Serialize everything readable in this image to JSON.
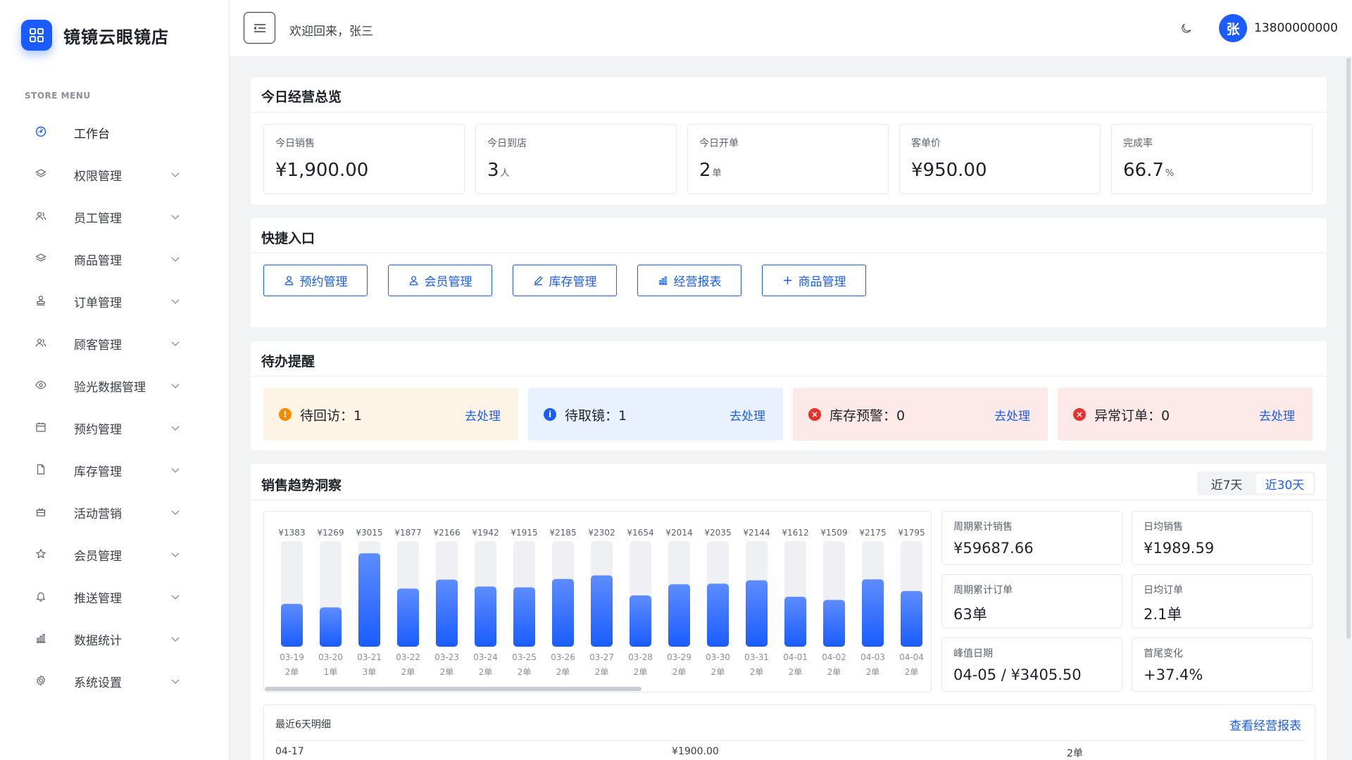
{
  "app": {
    "brand": "镜镜云眼镜店",
    "menu_caption": "STORE MENU"
  },
  "sidebar": {
    "items": [
      {
        "label": "工作台",
        "icon": "dashboard-icon",
        "active": true
      },
      {
        "label": "权限管理",
        "icon": "layers-icon"
      },
      {
        "label": "员工管理",
        "icon": "users-icon"
      },
      {
        "label": "商品管理",
        "icon": "layers-icon"
      },
      {
        "label": "订单管理",
        "icon": "stamp-icon"
      },
      {
        "label": "顾客管理",
        "icon": "users-icon"
      },
      {
        "label": "验光数据管理",
        "icon": "eye-icon"
      },
      {
        "label": "预约管理",
        "icon": "calendar-icon"
      },
      {
        "label": "库存管理",
        "icon": "document-icon"
      },
      {
        "label": "活动营销",
        "icon": "gift-icon"
      },
      {
        "label": "会员管理",
        "icon": "star-icon"
      },
      {
        "label": "推送管理",
        "icon": "bell-icon"
      },
      {
        "label": "数据统计",
        "icon": "bar-chart-icon"
      },
      {
        "label": "系统设置",
        "icon": "gear-icon"
      }
    ]
  },
  "header": {
    "welcome": "欢迎回来，张三",
    "avatar_text": "张",
    "phone": "13800000000"
  },
  "overview": {
    "title": "今日经营总览",
    "stats": [
      {
        "label": "今日销售",
        "value": "¥1,900.00",
        "unit": ""
      },
      {
        "label": "今日到店",
        "value": "3",
        "unit": "人"
      },
      {
        "label": "今日开单",
        "value": "2",
        "unit": "单"
      },
      {
        "label": "客单价",
        "value": "¥950.00",
        "unit": ""
      },
      {
        "label": "完成率",
        "value": "66.7",
        "unit": "%"
      }
    ]
  },
  "quick": {
    "title": "快捷入口",
    "buttons": [
      {
        "label": "预约管理",
        "icon": "user-icon"
      },
      {
        "label": "会员管理",
        "icon": "user-icon"
      },
      {
        "label": "库存管理",
        "icon": "edit-icon"
      },
      {
        "label": "经营报表",
        "icon": "bar-chart-icon"
      },
      {
        "label": "商品管理",
        "icon": "plus-icon"
      }
    ]
  },
  "todo": {
    "title": "待办提醒",
    "items": [
      {
        "label": "待回访：1",
        "action": "去处理",
        "type": "warning",
        "bg": "#fdf4e6",
        "icon_color": "#f08c00",
        "icon_glyph": "!"
      },
      {
        "label": "待取镜：1",
        "action": "去处理",
        "type": "info",
        "bg": "#e8f1fd",
        "icon_color": "#1a5cff",
        "icon_glyph": "i"
      },
      {
        "label": "库存预警：0",
        "action": "去处理",
        "type": "danger",
        "bg": "#fde9e8",
        "icon_color": "#e5322d",
        "icon_glyph": "×"
      },
      {
        "label": "异常订单：0",
        "action": "去处理",
        "type": "danger",
        "bg": "#fde9e8",
        "icon_color": "#e5322d",
        "icon_glyph": "×"
      }
    ]
  },
  "trend": {
    "title": "销售趋势洞察",
    "range_options": [
      "近7天",
      "近30天"
    ],
    "range_selected": "近30天",
    "metrics": [
      {
        "label": "周期累计销售",
        "value": "¥59687.66"
      },
      {
        "label": "日均销售",
        "value": "¥1989.59"
      },
      {
        "label": "周期累计订单",
        "value": "63单"
      },
      {
        "label": "日均订单",
        "value": "2.1单"
      },
      {
        "label": "峰值日期",
        "value": "04-05 / ¥3405.50"
      },
      {
        "label": "首尾变化",
        "value": "+37.4%"
      }
    ]
  },
  "chart_data": {
    "type": "bar",
    "categories": [
      "03-19",
      "03-20",
      "03-21",
      "03-22",
      "03-23",
      "03-24",
      "03-25",
      "03-26",
      "03-27",
      "03-28",
      "03-29",
      "03-30",
      "03-31",
      "04-01",
      "04-02",
      "04-03",
      "04-04"
    ],
    "values": [
      1383,
      1269,
      3015,
      1877,
      2166,
      1942,
      1915,
      2185,
      2302,
      1654,
      2014,
      2035,
      2144,
      1612,
      1509,
      2175,
      1795
    ],
    "value_labels": [
      "¥1383",
      "¥1269",
      "¥3015",
      "¥1877",
      "¥2166",
      "¥1942",
      "¥1915",
      "¥2185",
      "¥2302",
      "¥1654",
      "¥2014",
      "¥2035",
      "¥2144",
      "¥1612",
      "¥1509",
      "¥2175",
      "¥1795"
    ],
    "orders": [
      "2单",
      "1单",
      "3单",
      "2单",
      "2单",
      "2单",
      "2单",
      "2单",
      "2单",
      "2单",
      "2单",
      "2单",
      "2单",
      "2单",
      "2单",
      "2单",
      "2单"
    ],
    "ymax": 3405.5,
    "bar_color_top": "#5d8cff",
    "bar_color_bottom": "#1a5cff",
    "track_color": "#eef0f4"
  },
  "detail": {
    "title": "最近6天明细",
    "link": "查看经营报表",
    "rows": [
      {
        "date": "04-17",
        "amount": "¥1900.00",
        "orders": "2单"
      }
    ]
  },
  "colors": {
    "primary": "#1a5cff"
  }
}
